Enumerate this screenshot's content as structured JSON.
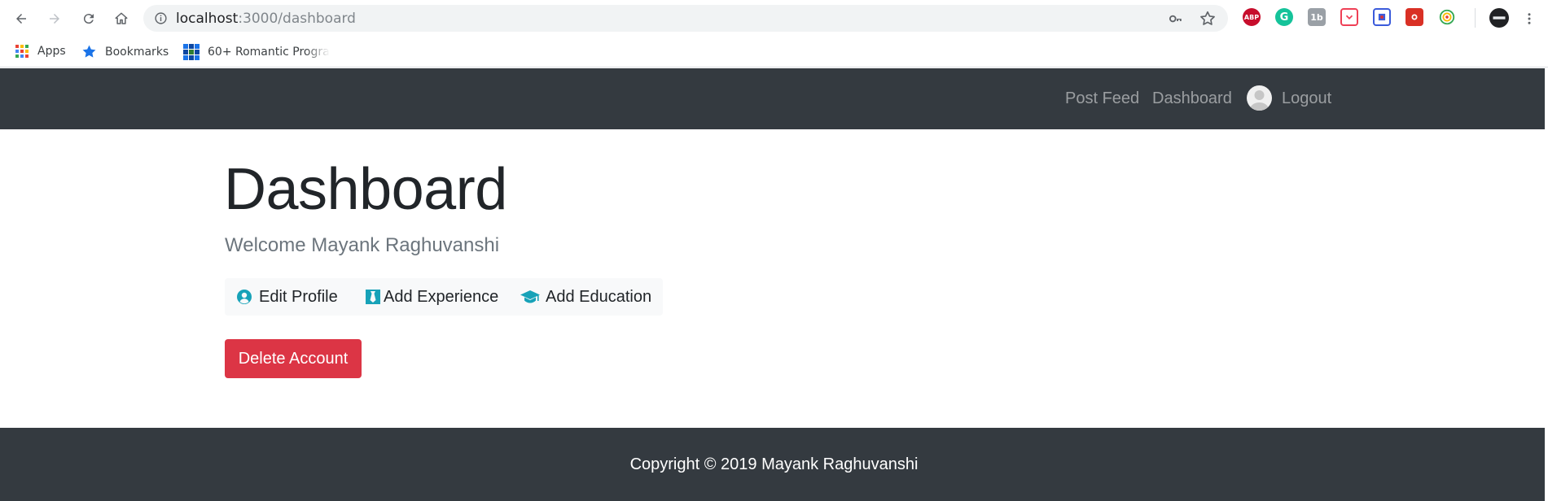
{
  "browser": {
    "url_host": "localhost",
    "url_path": ":3000/dashboard",
    "bookmarks": [
      {
        "label": "Apps",
        "icon": "apps-grid-icon"
      },
      {
        "label": "Bookmarks",
        "icon": "star-icon"
      },
      {
        "label": "60+ Romantic Progra",
        "icon": "site-favicon"
      }
    ],
    "extensions": [
      {
        "label": "ABP",
        "icon": "adblock-plus-icon",
        "color": "#c70d2c"
      },
      {
        "label": "G",
        "icon": "grammarly-icon",
        "color": "#15c39a"
      },
      {
        "label": "1b",
        "icon": "extension-1b-icon",
        "color": "#9aa0a6"
      },
      {
        "label": "",
        "icon": "pocket-icon",
        "color": "#ef4056"
      },
      {
        "label": "",
        "icon": "extension-blue-icon",
        "color": "#3b5bdb"
      },
      {
        "label": "",
        "icon": "extension-red-icon",
        "color": "#d93025"
      },
      {
        "label": "",
        "icon": "extension-circle-icon",
        "color": "#34a853"
      }
    ]
  },
  "navbar": {
    "links": [
      "Post Feed",
      "Dashboard",
      "Logout"
    ]
  },
  "main": {
    "title": "Dashboard",
    "welcome": "Welcome Mayank Raghuvanshi",
    "actions": [
      {
        "label": "Edit Profile",
        "icon": "user-circle-icon"
      },
      {
        "label": "Add Experience",
        "icon": "black-tie-icon"
      },
      {
        "label": "Add Education",
        "icon": "graduation-cap-icon"
      }
    ],
    "delete_label": "Delete Account"
  },
  "footer": {
    "text": "Copyright © 2019 Mayank Raghuvanshi"
  },
  "colors": {
    "navbar_bg": "#343a40",
    "danger": "#dc3545",
    "info": "#17a2b8",
    "light": "#f8f9fa"
  }
}
